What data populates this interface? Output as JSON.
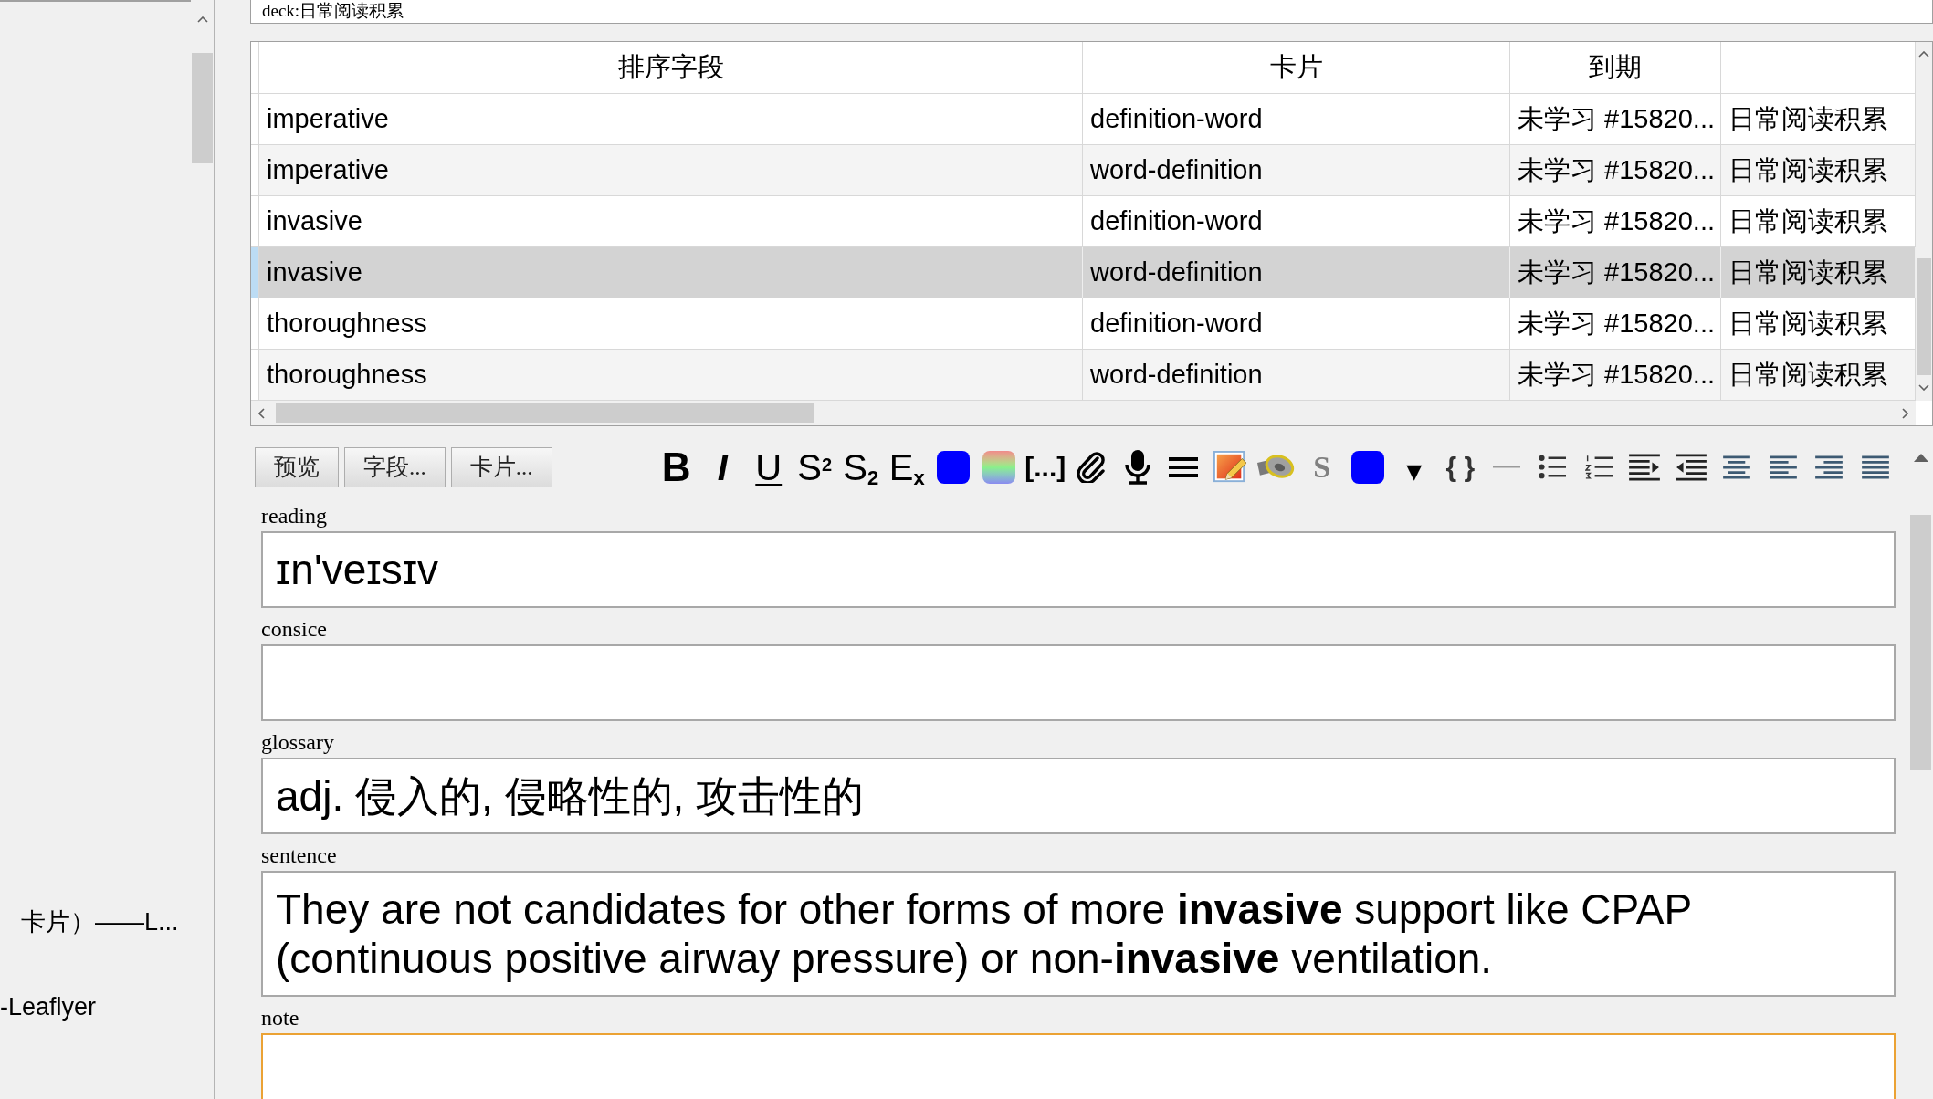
{
  "sidebar": {
    "items": [
      {
        "label": "卡片）——L..."
      },
      {
        "label": "-Leaflyer"
      }
    ]
  },
  "search": {
    "value": "deck:日常阅读积累"
  },
  "table": {
    "columns": [
      "排序字段",
      "卡片",
      "到期"
    ],
    "rows": [
      {
        "cells": [
          "imperative",
          "definition-word",
          "未学习 #15820...",
          "日常阅读积累"
        ],
        "selected": false
      },
      {
        "cells": [
          "imperative",
          "word-definition",
          "未学习 #15820...",
          "日常阅读积累"
        ],
        "selected": false
      },
      {
        "cells": [
          "invasive",
          "definition-word",
          "未学习 #15820...",
          "日常阅读积累"
        ],
        "selected": false
      },
      {
        "cells": [
          "invasive",
          "word-definition",
          "未学习 #15820...",
          "日常阅读积累"
        ],
        "selected": true
      },
      {
        "cells": [
          "thoroughness",
          "definition-word",
          "未学习 #15820...",
          "日常阅读积累"
        ],
        "selected": false
      },
      {
        "cells": [
          "thoroughness",
          "word-definition",
          "未学习 #15820...",
          "日常阅读积累"
        ],
        "selected": false
      }
    ]
  },
  "editor": {
    "buttons": [
      "预览",
      "字段...",
      "卡片..."
    ],
    "toolbar": {
      "format": [
        {
          "label": "B",
          "kind": "bold"
        },
        {
          "label": "I",
          "kind": "italic"
        },
        {
          "label": "U",
          "kind": "underline"
        },
        {
          "label": "S$^{2}$",
          "kind": "plain"
        },
        {
          "label": "S$_{2}$",
          "kind": "plain"
        },
        {
          "label": "E$_{x}$",
          "kind": "plain"
        }
      ],
      "cloze": "[...]",
      "strike": "S",
      "dropdown": "▼",
      "braces": "{ }"
    },
    "fields": [
      {
        "label": "reading",
        "value": "ɪn'veɪsɪv",
        "focused": false
      },
      {
        "label": "consice",
        "focused": false
      },
      {
        "label": "glossary",
        "value": "adj. 侵入的, 侵略性的, 攻击性的",
        "focused": false
      },
      {
        "label": "sentence",
        "value": "They are not candidates for other forms of more **invasive** support like CPAP (continuous positive airway pressure) or non-**invasive** ventilation.",
        "focused": false
      },
      {
        "label": "note",
        "focused": true
      }
    ]
  }
}
